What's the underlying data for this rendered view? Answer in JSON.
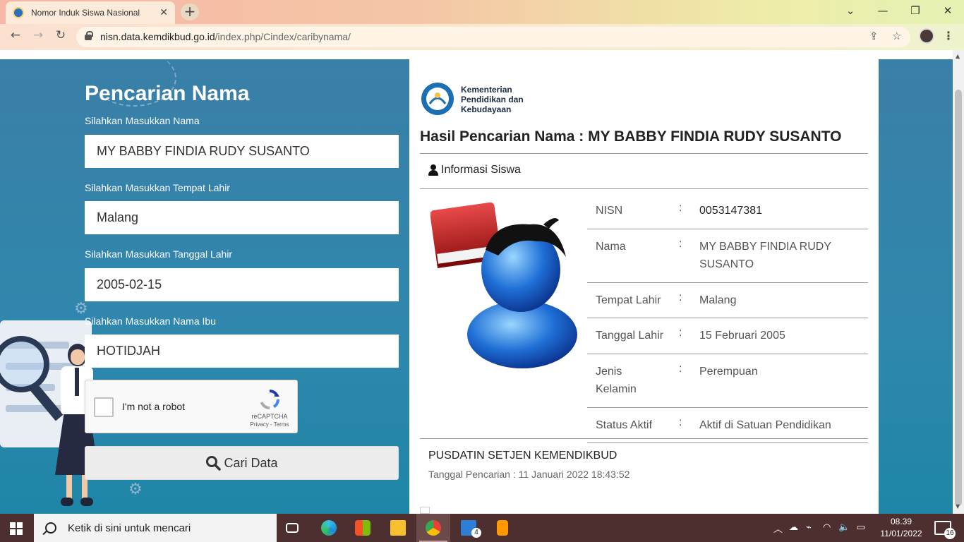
{
  "browser": {
    "tab_title": "Nomor Induk Siswa Nasional",
    "url_domain": "nisn.data.kemdikbud.go.id",
    "url_path": "/index.php/Cindex/caribynama/"
  },
  "form": {
    "title": "Pencarian Nama",
    "name_label": "Silahkan Masukkan Nama",
    "name_value": "MY BABBY FINDIA RUDY SUSANTO",
    "birthplace_label": "Silahkan Masukkan Tempat Lahir",
    "birthplace_value": "Malang",
    "birthdate_label": "Silahkan Masukkan Tanggal Lahir",
    "birthdate_value": "2005-02-15",
    "mother_label": "Silahkan Masukkan Nama Ibu",
    "mother_value": "HOTIDJAH",
    "captcha_text": "I'm not a robot",
    "captcha_brand": "reCAPTCHA",
    "captcha_links": "Privacy - Terms",
    "submit_label": "Cari Data"
  },
  "result": {
    "logo_text_1": "Kementerian",
    "logo_text_2": "Pendidikan dan",
    "logo_text_3": "Kebudayaan",
    "heading": "Hasil Pencarian Nama : MY BABBY FINDIA RUDY SUSANTO",
    "section_title": "Informasi Siswa",
    "rows": [
      {
        "key": "NISN",
        "sep": ":",
        "value": "0053147381"
      },
      {
        "key": "Nama",
        "sep": ":",
        "value": "MY BABBY FINDIA RUDY SUSANTO"
      },
      {
        "key": "Tempat Lahir",
        "sep": ":",
        "value": "Malang"
      },
      {
        "key": "Tanggal Lahir",
        "sep": ":",
        "value": "15 Februari 2005"
      },
      {
        "key": "Jenis Kelamin",
        "sep": ":",
        "value": "Perempuan"
      },
      {
        "key": "Status Aktif",
        "sep": ":",
        "value": "Aktif di Satuan Pendidikan"
      }
    ],
    "footer_org": "PUSDATIN SETJEN KEMENDIKBUD",
    "footer_date": "Tanggal Pencarian : 11 Januari 2022 18:43:52"
  },
  "taskbar": {
    "search_placeholder": "Ketik di sini untuk mencari",
    "mail_badge": "4",
    "time": "08.39",
    "date": "11/01/2022",
    "notif_count": "16"
  },
  "colors": {
    "page_bg": "#2f87ad",
    "taskbar": "#4e2f2f",
    "tabbar_gradient_start": "#f7b6a6"
  }
}
